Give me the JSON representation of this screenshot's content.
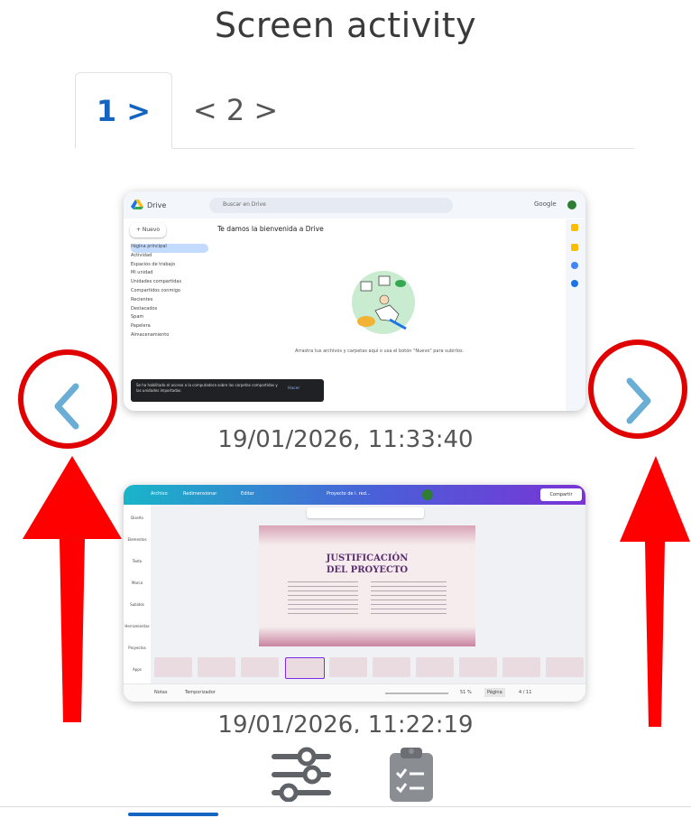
{
  "header": {
    "title": "Screen activity"
  },
  "tabs": [
    {
      "label": "1 >"
    },
    {
      "label": "< 2 >"
    }
  ],
  "screenshots": [
    {
      "timestamp": "19/01/2026, 11:33:40",
      "app": {
        "name": "Drive",
        "search_placeholder": "Buscar en Drive",
        "account": "Google",
        "new_button": "+ Nuevo",
        "welcome": "Te damos la bienvenida a Drive",
        "sidebar": [
          "Página principal",
          "Actividad",
          "Espacios de trabajo",
          "Mi unidad",
          "Unidades compartidas",
          "Compartidos conmigo",
          "Recientes",
          "Destacados",
          "Spam",
          "Papelera",
          "Almacenamiento"
        ],
        "caption": "Arrastra tus archivos y carpetas aquí o usa el botón \"Nuevo\" para subirlos.",
        "toast": "Se ha habilitado el acceso a la computadora sobre las carpetas compartidas y las unidades importadas.",
        "toast_action": "Hacer"
      }
    },
    {
      "timestamp": "19/01/2026, 11:22:19",
      "app": {
        "menu": [
          "Archivo",
          "Redimensionar",
          "Editar"
        ],
        "doc_name": "Proyecto de l. red...",
        "share_button": "Compartir",
        "slide_title_line1": "JUSTIFICACIÓN",
        "slide_title_line2": "DEL PROYECTO",
        "sidebar": [
          "Diseño",
          "Elementos",
          "Texto",
          "Marca",
          "Subidos",
          "Herramientas",
          "Proyectos",
          "Apps"
        ],
        "footer_left": [
          "Notas",
          "Temporizador"
        ],
        "zoom": "51 %",
        "pages": "Página",
        "page_count": "4 / 11"
      }
    }
  ],
  "bottom_nav": [
    {
      "icon": "sliders-icon"
    },
    {
      "icon": "clipboard-icon"
    }
  ],
  "colors": {
    "accent": "#1565c0",
    "annotation": "#e00000",
    "chevron": "#6aaed6"
  }
}
